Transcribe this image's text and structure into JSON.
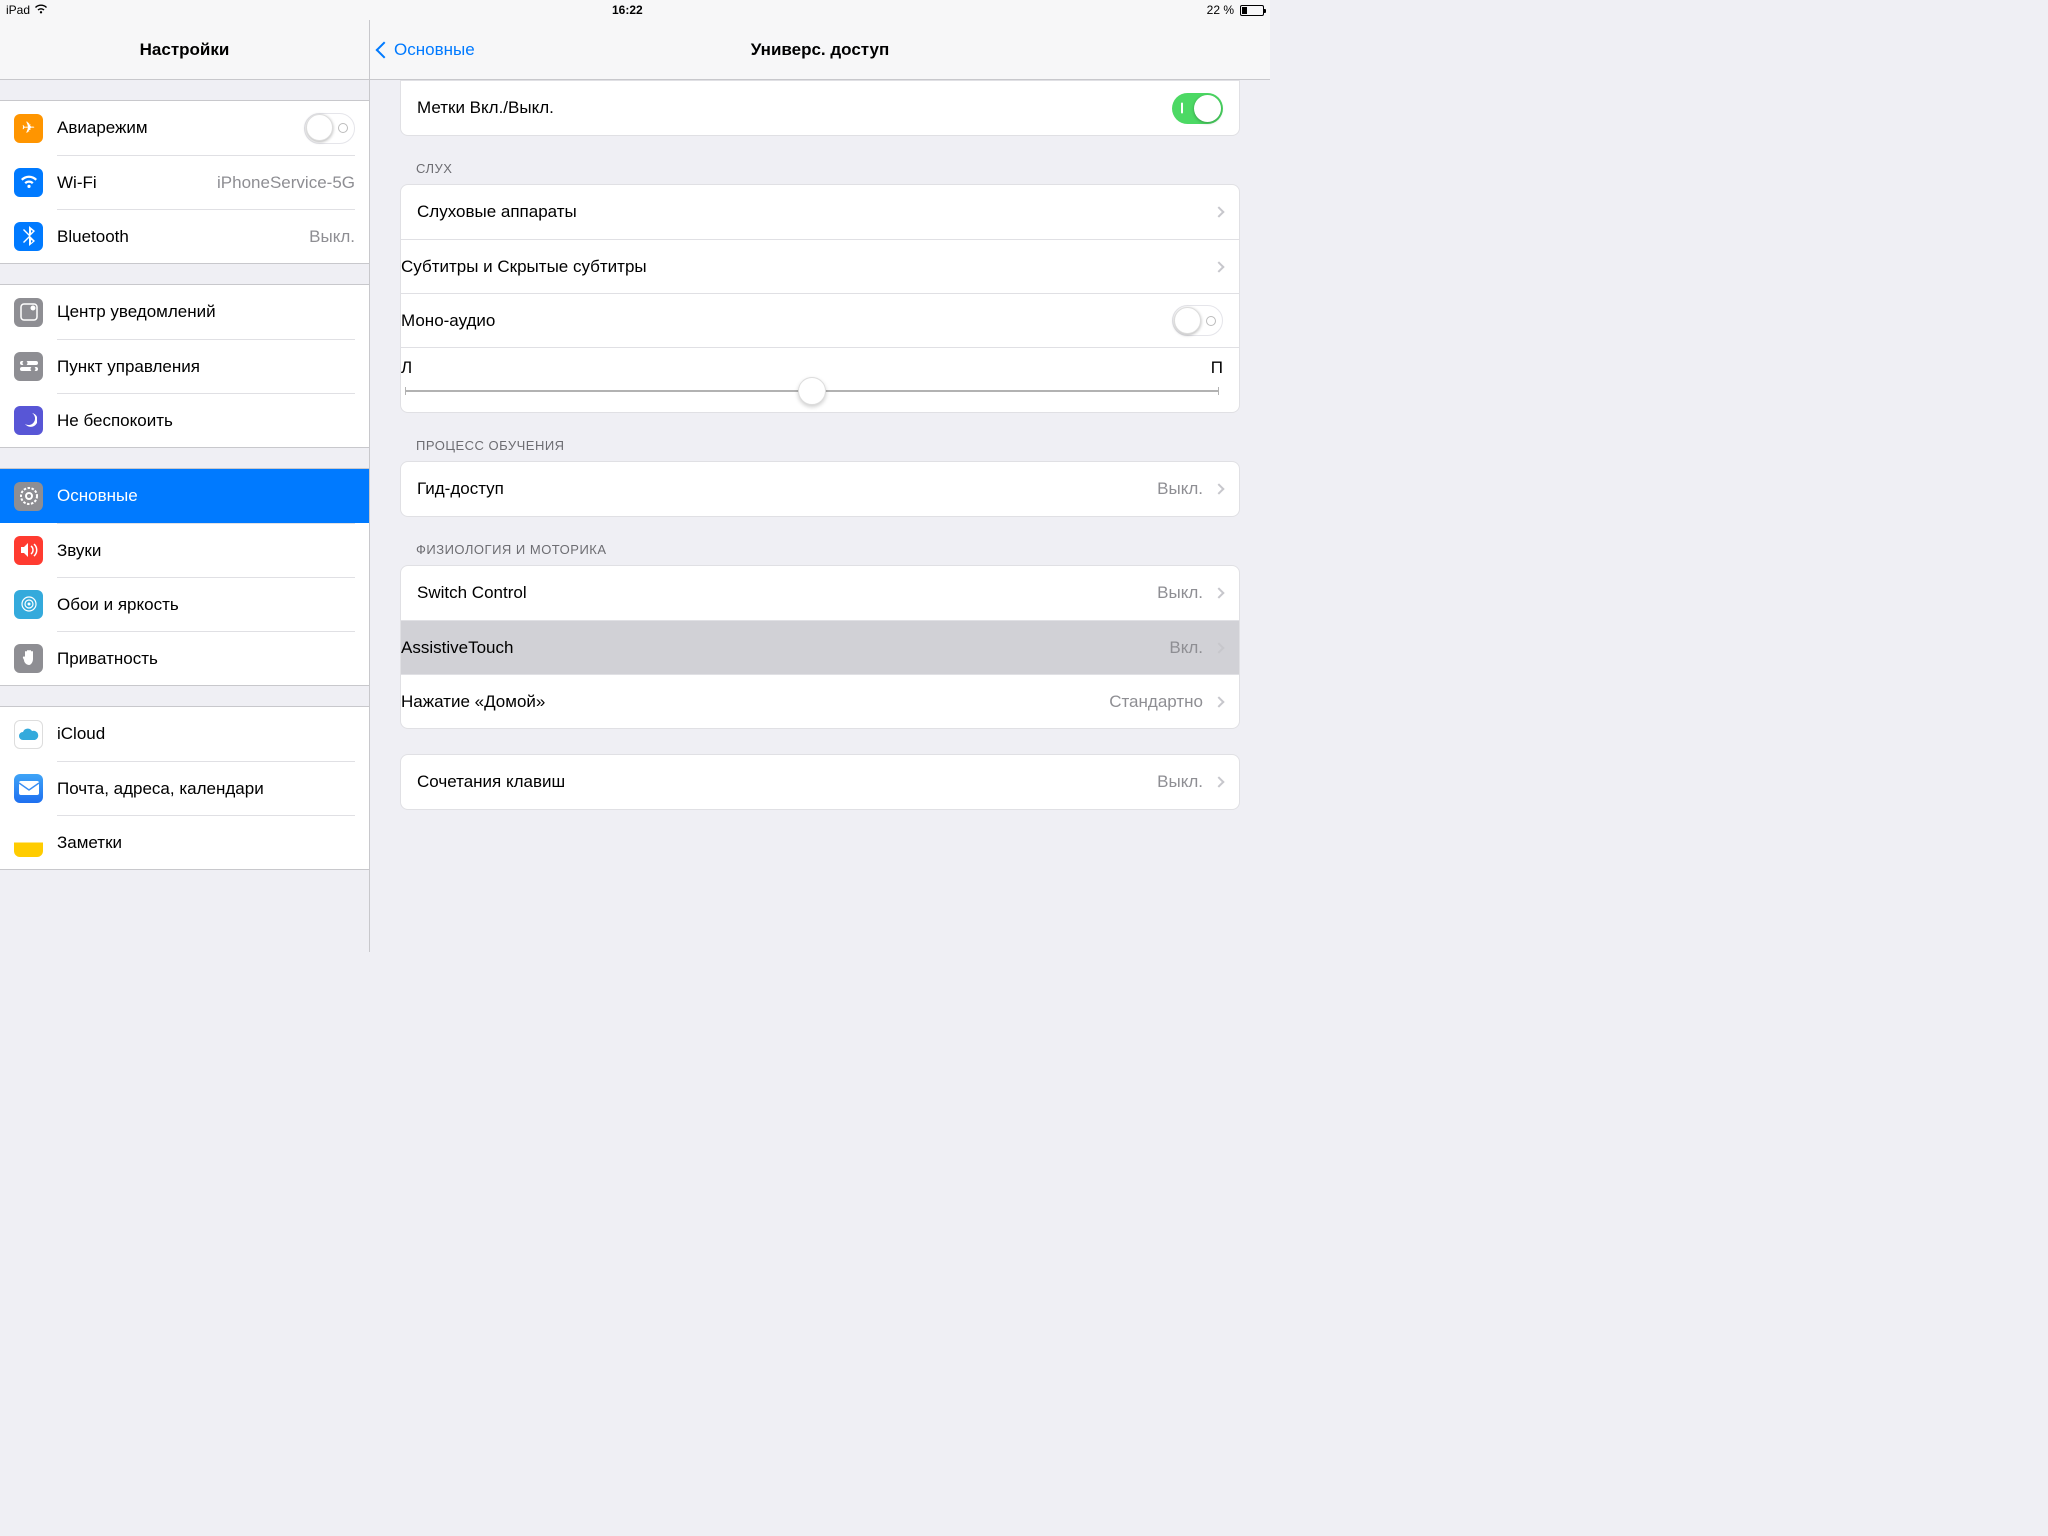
{
  "statusbar": {
    "device": "iPad",
    "time": "16:22",
    "battery_pct": "22 %"
  },
  "sidebar": {
    "title": "Настройки",
    "g1": {
      "airplane": "Авиарежим",
      "wifi": "Wi-Fi",
      "wifi_val": "iPhoneService-5G",
      "bluetooth": "Bluetooth",
      "bluetooth_val": "Выкл."
    },
    "g2": {
      "notif": "Центр уведомлений",
      "control": "Пункт управления",
      "dnd": "Не беспокоить"
    },
    "g3": {
      "general": "Основные",
      "sounds": "Звуки",
      "wallpaper": "Обои и яркость",
      "privacy": "Приватность"
    },
    "g4": {
      "icloud": "iCloud",
      "mail": "Почта, адреса, календари",
      "notes": "Заметки"
    }
  },
  "content": {
    "back": "Основные",
    "title": "Универс. доступ",
    "row_labels": "Метки Вкл./Выкл.",
    "sec_hearing": "СЛУХ",
    "hearing_aids": "Слуховые аппараты",
    "subtitles": "Субтитры и Скрытые субтитры",
    "mono": "Моно-аудио",
    "balance_left": "Л",
    "balance_right": "П",
    "sec_learning": "ПРОЦЕСС ОБУЧЕНИЯ",
    "guided": "Гид-доступ",
    "guided_val": "Выкл.",
    "sec_motor": "ФИЗИОЛОГИЯ И МОТОРИКА",
    "switch": "Switch Control",
    "switch_val": "Выкл.",
    "assistive": "AssistiveTouch",
    "assistive_val": "Вкл.",
    "home": "Нажатие «Домой»",
    "home_val": "Стандартно",
    "shortcut": "Сочетания клавиш",
    "shortcut_val": "Выкл."
  }
}
